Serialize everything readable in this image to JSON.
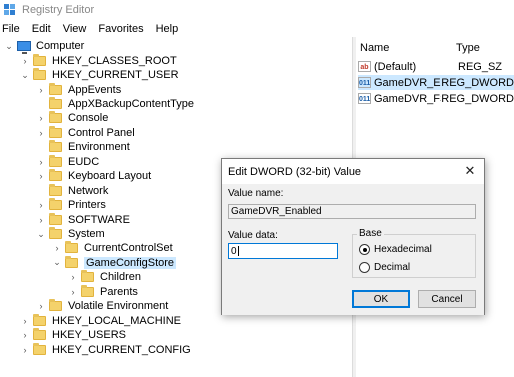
{
  "window": {
    "title": "Registry Editor"
  },
  "menu": [
    "File",
    "Edit",
    "View",
    "Favorites",
    "Help"
  ],
  "tree": [
    {
      "label": "Computer",
      "depth": 0,
      "expander": "open",
      "icon": "computer-icon"
    },
    {
      "label": "HKEY_CLASSES_ROOT",
      "depth": 1,
      "expander": "closed",
      "icon": "folder-icon"
    },
    {
      "label": "HKEY_CURRENT_USER",
      "depth": 1,
      "expander": "open",
      "icon": "folder-icon"
    },
    {
      "label": "AppEvents",
      "depth": 2,
      "expander": "closed",
      "icon": "folder-icon"
    },
    {
      "label": "AppXBackupContentType",
      "depth": 2,
      "expander": "none",
      "icon": "folder-icon"
    },
    {
      "label": "Console",
      "depth": 2,
      "expander": "closed",
      "icon": "folder-icon"
    },
    {
      "label": "Control Panel",
      "depth": 2,
      "expander": "closed",
      "icon": "folder-icon"
    },
    {
      "label": "Environment",
      "depth": 2,
      "expander": "none",
      "icon": "folder-icon"
    },
    {
      "label": "EUDC",
      "depth": 2,
      "expander": "closed",
      "icon": "folder-icon"
    },
    {
      "label": "Keyboard Layout",
      "depth": 2,
      "expander": "closed",
      "icon": "folder-icon"
    },
    {
      "label": "Network",
      "depth": 2,
      "expander": "none",
      "icon": "folder-icon"
    },
    {
      "label": "Printers",
      "depth": 2,
      "expander": "closed",
      "icon": "folder-icon"
    },
    {
      "label": "SOFTWARE",
      "depth": 2,
      "expander": "closed",
      "icon": "folder-icon"
    },
    {
      "label": "System",
      "depth": 2,
      "expander": "open",
      "icon": "folder-icon"
    },
    {
      "label": "CurrentControlSet",
      "depth": 3,
      "expander": "closed",
      "icon": "folder-icon"
    },
    {
      "label": "GameConfigStore",
      "depth": 3,
      "expander": "open",
      "icon": "folder-icon",
      "selected": true
    },
    {
      "label": "Children",
      "depth": 4,
      "expander": "closed",
      "icon": "folder-icon"
    },
    {
      "label": "Parents",
      "depth": 4,
      "expander": "closed",
      "icon": "folder-icon"
    },
    {
      "label": "Volatile Environment",
      "depth": 2,
      "expander": "closed",
      "icon": "folder-icon"
    },
    {
      "label": "HKEY_LOCAL_MACHINE",
      "depth": 1,
      "expander": "closed",
      "icon": "folder-icon"
    },
    {
      "label": "HKEY_USERS",
      "depth": 1,
      "expander": "closed",
      "icon": "folder-icon"
    },
    {
      "label": "HKEY_CURRENT_CONFIG",
      "depth": 1,
      "expander": "closed",
      "icon": "folder-icon"
    }
  ],
  "values_pane": {
    "columns": [
      "Name",
      "Type"
    ],
    "rows": [
      {
        "name": "(Default)",
        "type": "REG_SZ",
        "icon": "ab",
        "selected": false
      },
      {
        "name": "GameDVR_Enab...",
        "type": "REG_DWORD",
        "icon": "011",
        "selected": true
      },
      {
        "name": "GameDVR_FSEB...",
        "type": "REG_DWORD",
        "icon": "011",
        "selected": false
      }
    ]
  },
  "dialog": {
    "title": "Edit DWORD (32-bit) Value",
    "close_glyph": "✕",
    "value_name_label": "Value name:",
    "value_name": "GameDVR_Enabled",
    "value_data_label": "Value data:",
    "value_data": "0",
    "base_label": "Base",
    "base_options": [
      "Hexadecimal",
      "Decimal"
    ],
    "base_selected": "Hexadecimal",
    "ok_label": "OK",
    "cancel_label": "Cancel"
  },
  "colors": {
    "selection": "#cce8ff",
    "accent": "#0078d7",
    "folder": "#f4d26b"
  }
}
